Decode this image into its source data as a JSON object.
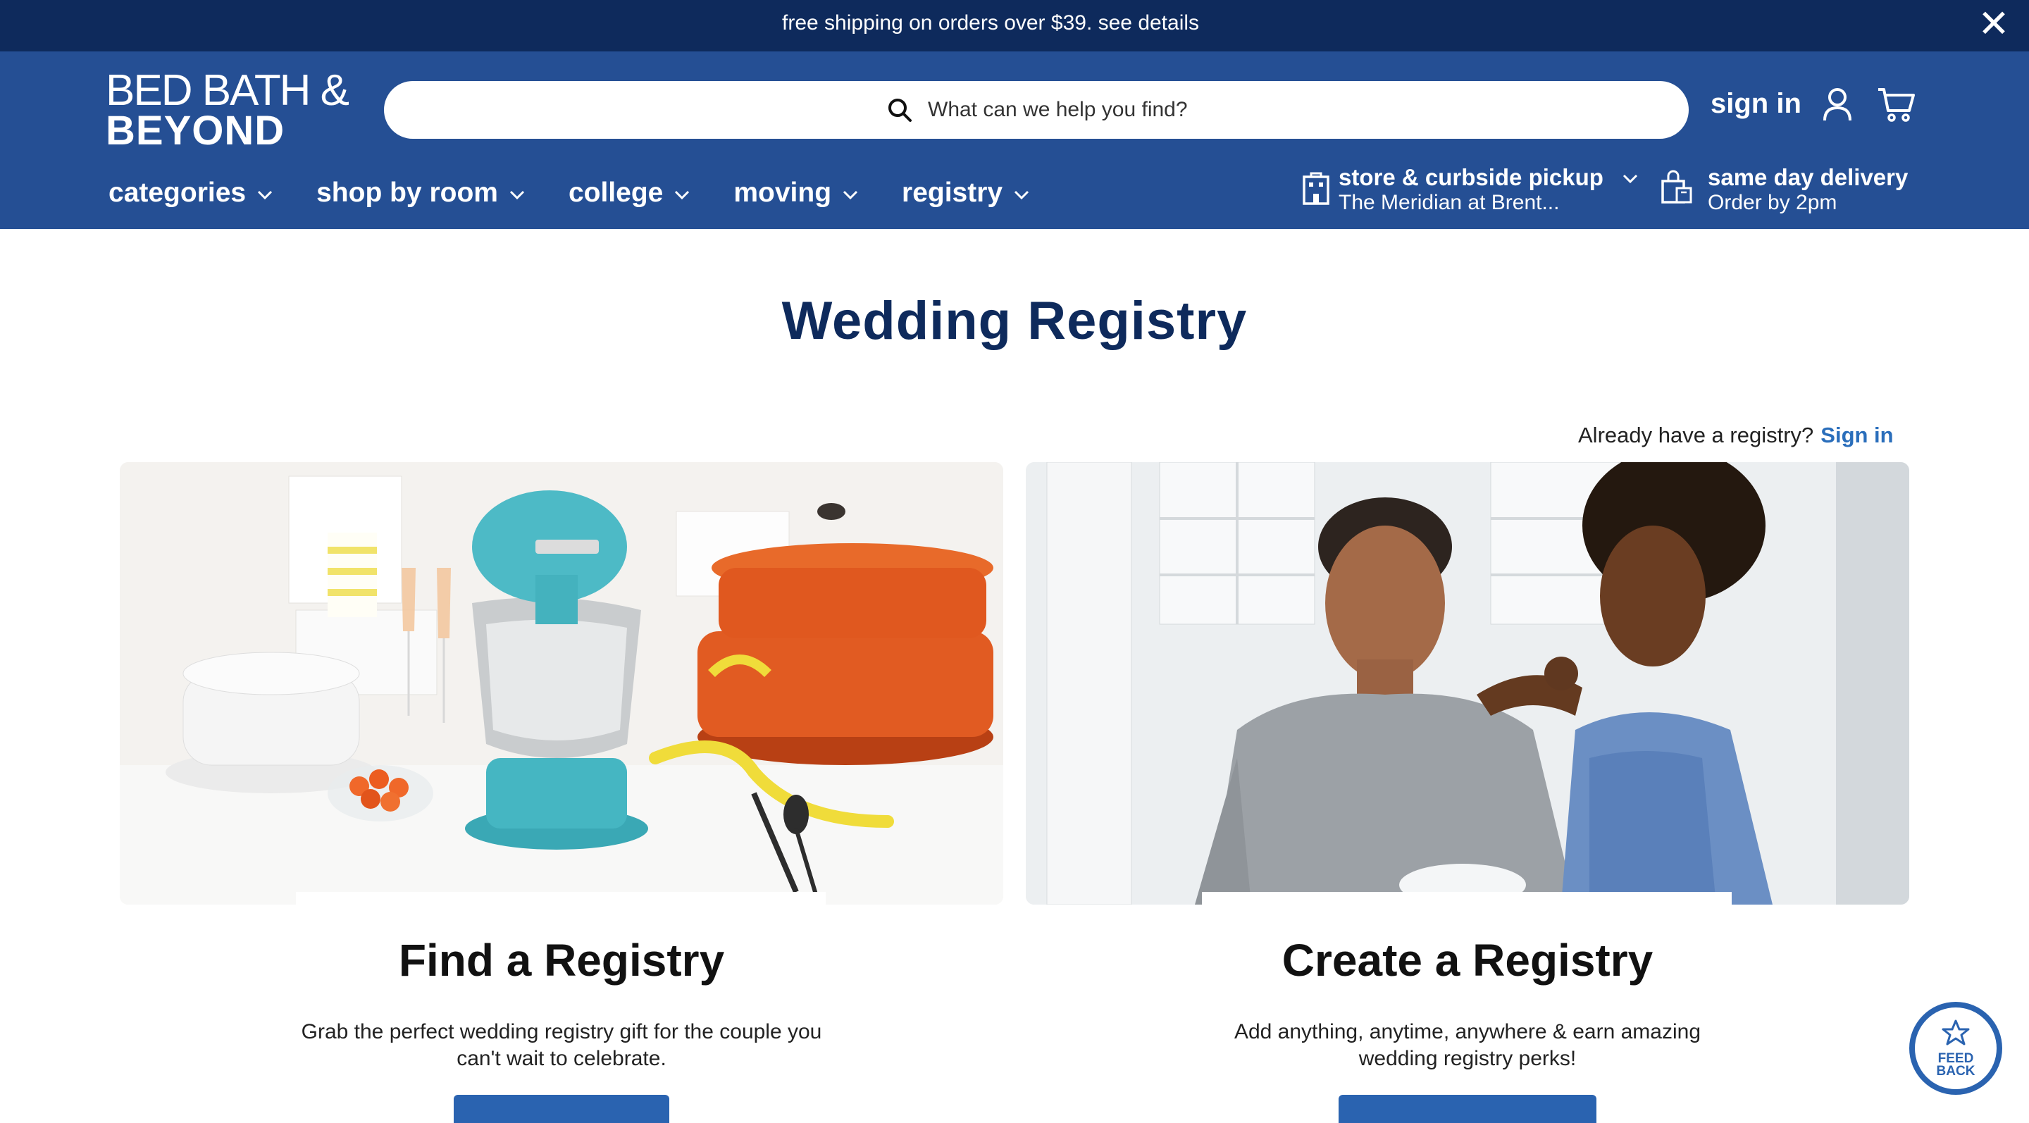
{
  "promo": {
    "text": "free shipping on orders over $39. see details",
    "close_icon": "close-icon"
  },
  "header": {
    "logo_line1": "BED BATH &",
    "logo_line2": "BEYOND",
    "search_placeholder": "What can we help you find?",
    "sign_in_label": "sign in",
    "icons": [
      "search-icon",
      "user-icon",
      "cart-icon"
    ],
    "nav": [
      {
        "label": "categories"
      },
      {
        "label": "shop by room"
      },
      {
        "label": "college"
      },
      {
        "label": "moving"
      },
      {
        "label": "registry"
      }
    ],
    "store": {
      "title": "store & curbside pickup",
      "subtitle": "The Meridian at Brent..."
    },
    "delivery": {
      "title": "same day delivery",
      "subtitle": "Order by 2pm"
    }
  },
  "main": {
    "title": "Wedding Registry",
    "already_text": "Already have a registry?",
    "already_link": "Sign in",
    "cards": [
      {
        "title": "Find a Registry",
        "description": "Grab the perfect wedding registry gift for the couple you can't wait to celebrate."
      },
      {
        "title": "Create a Registry",
        "description": "Add anything, anytime, anywhere & earn amazing wedding registry perks!"
      }
    ]
  },
  "feedback": {
    "line1": "FEED",
    "line2": "BACK"
  },
  "colors": {
    "promo_bg": "#0e2a5c",
    "header_bg": "#254f94",
    "title_color": "#0e2a5c",
    "link_blue": "#2a6ebb",
    "button_blue": "#2a63b0"
  }
}
